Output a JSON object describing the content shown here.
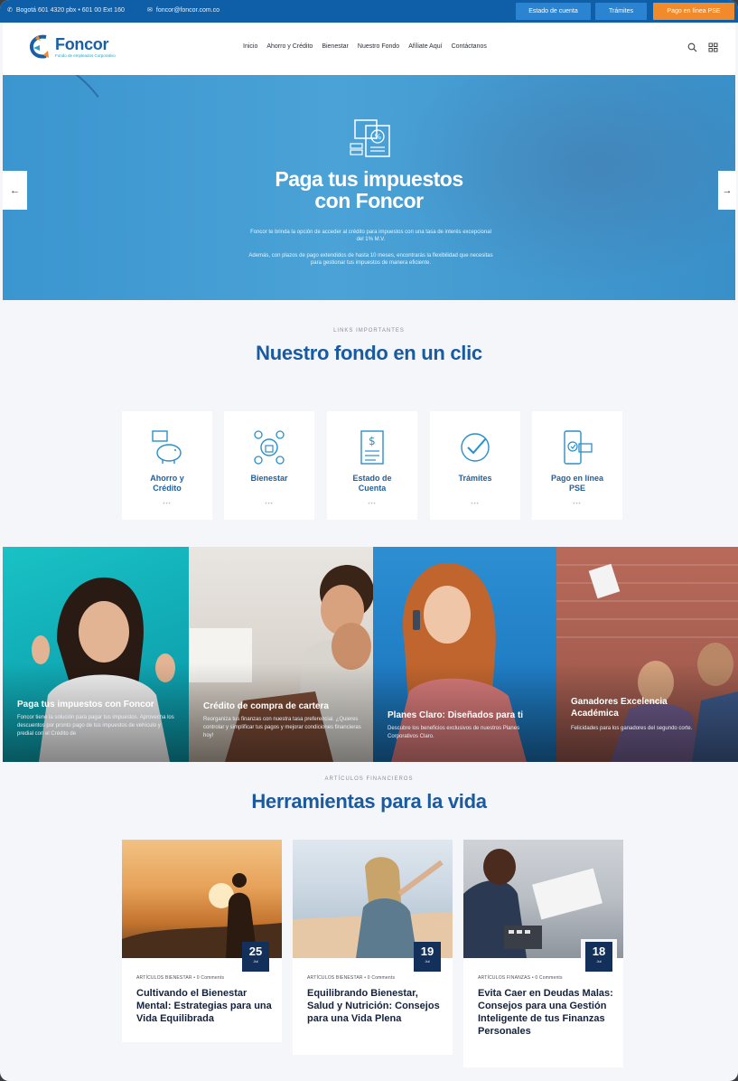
{
  "topbar": {
    "phone": "Bogotá 601 4320 pbx • 601 00 Ext 160",
    "email": "foncor@foncor.com.co",
    "buttons": [
      "Estado de cuenta",
      "Trámites",
      "Pago en línea PSE"
    ],
    "colors": {
      "bar": "#0f5fa8",
      "btn": "#2b84d1",
      "cta": "#f08a2a"
    }
  },
  "header": {
    "logo_name": "Foncor",
    "logo_tagline": "Fondo de empleados Corporativo",
    "nav": [
      "Inicio",
      "Ahorro y Crédito",
      "Bienestar",
      "Nuestro Fondo",
      "Afíliate Aquí",
      "Contáctanos"
    ],
    "icons": [
      "search-icon",
      "grid-menu-icon"
    ]
  },
  "hero": {
    "title_line1": "Paga tus impuestos",
    "title_line2": "con Foncor",
    "paragraph1": "Foncor te brinda la opción de acceder al crédito para impuestos con una tasa de interés excepcional del 1% M.V.",
    "paragraph2": "Además, con plazos de pago extendidos de hasta 10 meses, encontrarás la flexibilidad que necesitas para gestionar tus impuestos de manera eficiente.",
    "prev_arrow": "←",
    "next_arrow": "→"
  },
  "links": {
    "eyebrow": "LINKS IMPORTANTES",
    "title": "Nuestro fondo en un clic",
    "cards": [
      {
        "label1": "Ahorro y",
        "label2": "Crédito",
        "icon": "piggy-bank-icon",
        "dots": "•••"
      },
      {
        "label1": "Bienestar",
        "label2": "",
        "icon": "wellbeing-icon",
        "dots": "•••"
      },
      {
        "label1": "Estado de",
        "label2": "Cuenta",
        "icon": "statement-icon",
        "dots": "•••"
      },
      {
        "label1": "Trámites",
        "label2": "",
        "icon": "check-badge-icon",
        "dots": "•••"
      },
      {
        "label1": "Pago en línea",
        "label2": "PSE",
        "icon": "mobile-payment-icon",
        "dots": "•••"
      }
    ]
  },
  "promos": [
    {
      "title1": "Paga tus impuestos con Foncor",
      "title2": "",
      "text": "Foncor tiene la solución para pagar tus impuestos. Aprovecha los descuentos por pronto pago de tus impuestos de vehículo y predial con el Crédito de"
    },
    {
      "title1": "Crédito de compra de cartera",
      "title2": "",
      "text": "Reorganiza tus finanzas con nuestra tasa preferencial. ¿Quieres controlar y simplificar tus pagos y mejorar condiciones financieras hoy!"
    },
    {
      "title1": "Planes Claro: Diseñados para ti",
      "title2": "",
      "text": "Descubre los beneficios exclusivos de nuestros Planes Corporativos Claro."
    },
    {
      "title1": "Ganadores Excelencia",
      "title2": "Académica",
      "text": "Felicidades para los ganadores del segundo corte."
    }
  ],
  "articles_section": {
    "eyebrow": "ARTÍCULOS FINANCIEROS",
    "title": "Herramientas para la vida",
    "articles": [
      {
        "day": "25",
        "month": "Jul",
        "meta": "ARTÍCULOS BIENESTAR  •  0 Comments",
        "title": "Cultivando el Bienestar Mental: Estrategias para una Vida Equilibrada"
      },
      {
        "day": "19",
        "month": "Jul",
        "meta": "ARTÍCULOS BIENESTAR  •  0 Comments",
        "title": "Equilibrando Bienestar, Salud y Nutrición: Consejos para una Vida Plena"
      },
      {
        "day": "18",
        "month": "Jul",
        "meta": "ARTÍCULOS FINANZAS  •  0 Comments",
        "title": "Evita Caer en Deudas Malas: Consejos para una Gestión Inteligente de tus Finanzas Personales"
      }
    ]
  },
  "colors": {
    "brand_blue": "#1a5aa0",
    "hero_blue": "#3b95cf",
    "accent_orange": "#f08a2a",
    "date_navy": "#12305a"
  }
}
